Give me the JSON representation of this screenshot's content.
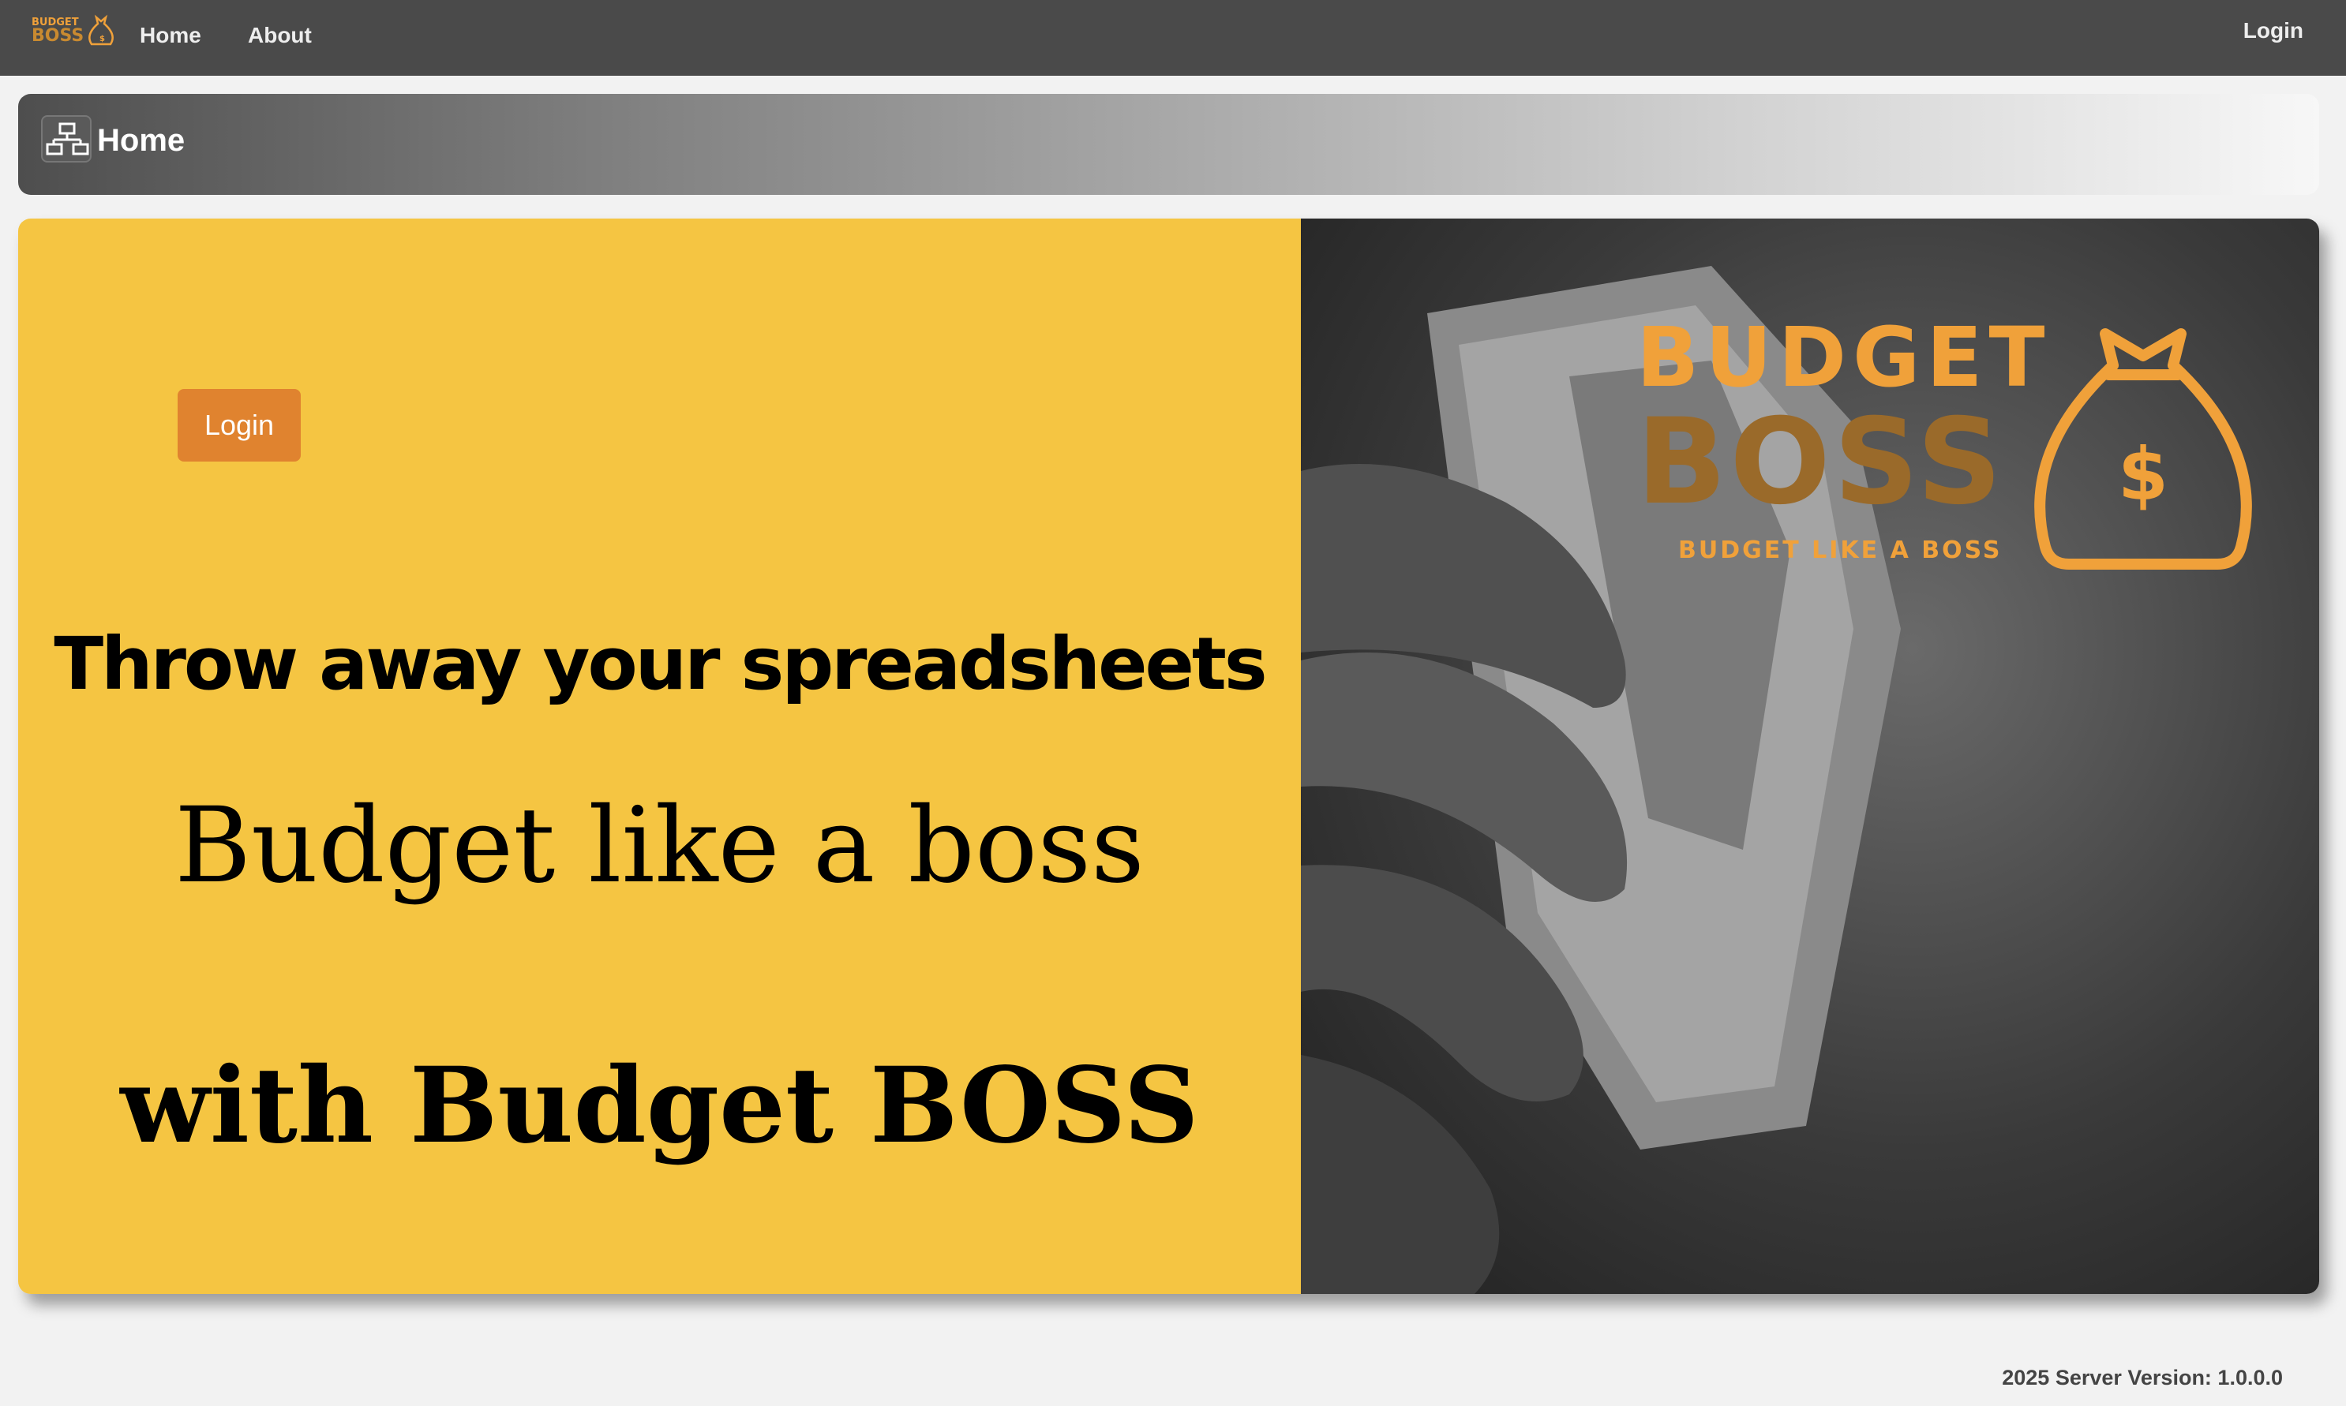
{
  "navbar": {
    "logo": {
      "text_top": "BUDGET",
      "text_bottom": "BOSS",
      "icon": "money-bag-icon"
    },
    "links": {
      "home": "Home",
      "about": "About",
      "login": "Login"
    }
  },
  "breadcrumb": {
    "icon": "sitemap-icon",
    "title": "Home"
  },
  "hero": {
    "login_button": "Login",
    "headline": "Throw away your spreadsheets",
    "subheadline": "Budget like a boss",
    "tagline": "with Budget BOSS",
    "brand": {
      "word1": "BUDGET",
      "word2": "BOSS",
      "slogan": "BUDGET LIKE A BOSS",
      "icon": "money-bag-dollar-icon"
    }
  },
  "footer": {
    "version": "2025 Server Version: 1.0.0.0"
  },
  "colors": {
    "navbar": "#4a4a4a",
    "hero_yellow": "#f5c542",
    "login_orange": "#e0832f",
    "brand_orange": "#f0a13a",
    "brand_brown": "#9a6a2a"
  }
}
